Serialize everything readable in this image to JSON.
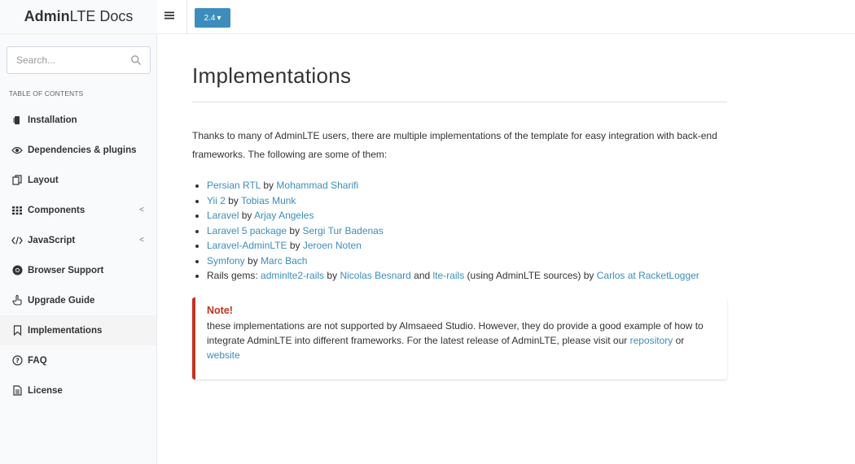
{
  "sidebar": {
    "logo_bold": "Admin",
    "logo_rest": "LTE Docs",
    "search_placeholder": "Search...",
    "toc_heading": "TABLE OF CONTENTS",
    "items": [
      {
        "label": "Installation",
        "icon": "hdd-icon",
        "has_children": false,
        "active": false
      },
      {
        "label": "Dependencies & plugins",
        "icon": "eye-icon",
        "has_children": false,
        "active": false
      },
      {
        "label": "Layout",
        "icon": "files-icon",
        "has_children": false,
        "active": false
      },
      {
        "label": "Components",
        "icon": "grid-icon",
        "has_children": true,
        "active": false
      },
      {
        "label": "JavaScript",
        "icon": "code-icon",
        "has_children": true,
        "active": false
      },
      {
        "label": "Browser Support",
        "icon": "chrome-icon",
        "has_children": false,
        "active": false
      },
      {
        "label": "Upgrade Guide",
        "icon": "hand-up-icon",
        "has_children": false,
        "active": false
      },
      {
        "label": "Implementations",
        "icon": "bookmark-icon",
        "has_children": false,
        "active": true
      },
      {
        "label": "FAQ",
        "icon": "question-circle-icon",
        "has_children": false,
        "active": false
      },
      {
        "label": "License",
        "icon": "document-icon",
        "has_children": false,
        "active": false
      }
    ],
    "chevron": "<"
  },
  "topbar": {
    "version_label": "2.4",
    "version_caret": "▾"
  },
  "main": {
    "title": "Implementations",
    "intro": "Thanks to many of AdminLTE users, there are multiple implementations of the template for easy integration with back-end frameworks. The following are some of them:",
    "by": "by",
    "and": "and",
    "implementations": [
      {
        "name": "Persian RTL",
        "author": "Mohammad Sharifi"
      },
      {
        "name": "Yii 2",
        "author": "Tobias Munk"
      },
      {
        "name": "Laravel",
        "author": "Arjay Angeles"
      },
      {
        "name": "Laravel 5 package",
        "author": "Sergi Tur Badenas"
      },
      {
        "name": "Laravel-AdminLTE",
        "author": "Jeroen Noten"
      },
      {
        "name": "Symfony",
        "author": "Marc Bach"
      }
    ],
    "rails": {
      "prefix": "Rails gems:",
      "gem1": "adminlte2-rails",
      "gem1_author": "Nicolas Besnard",
      "gem2": "lte-rails",
      "gem2_note": "(using AdminLTE sources) by",
      "gem2_author": "Carlos at RacketLogger"
    },
    "note": {
      "title": "Note!",
      "text": "these implementations are not supported by Almsaeed Studio. However, they do provide a good example of how to integrate AdminLTE into different frameworks. For the latest release of AdminLTE, please visit our",
      "repo_link": "repository",
      "or": "or",
      "website_link": "website"
    }
  },
  "colors": {
    "accent": "#3c8dbc",
    "note_border": "#c23321",
    "note_title": "#c23321"
  }
}
